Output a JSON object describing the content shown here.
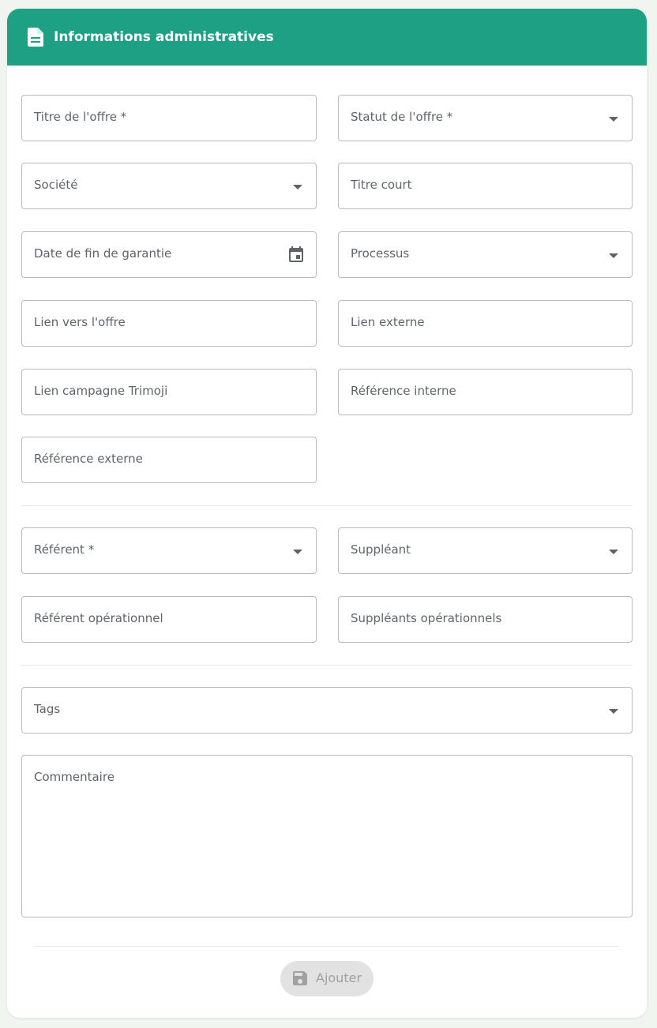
{
  "header": {
    "title": "Informations administratives",
    "icon": "document-icon",
    "background_color": "#1ea085"
  },
  "fields": {
    "titre_offre": "Titre de l'offre *",
    "statut_offre": "Statut de l'offre *",
    "societe": "Société",
    "titre_court": "Titre court",
    "date_fin_garantie": "Date de fin de garantie",
    "processus": "Processus",
    "lien_offre": "Lien vers l'offre",
    "lien_externe": "Lien externe",
    "lien_campagne": "Lien campagne Trimoji",
    "reference_interne": "Référence interne",
    "reference_externe": "Référence externe",
    "referent": "Référent *",
    "suppleant": "Suppléant",
    "referent_operationnel": "Référent opérationnel",
    "suppleants_operationnels": "Suppléants opérationnels",
    "tags": "Tags",
    "commentaire": "Commentaire"
  },
  "actions": {
    "add_label": "Ajouter",
    "add_icon": "save-icon"
  }
}
